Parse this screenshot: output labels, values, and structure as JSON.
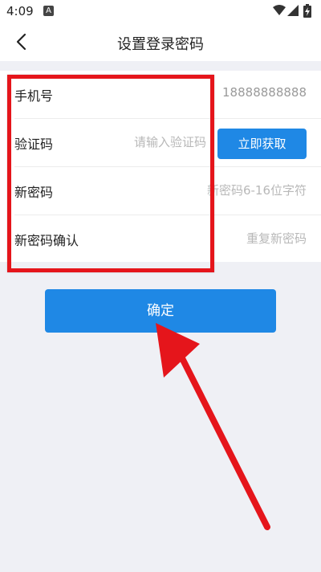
{
  "status_bar": {
    "time": "4:09",
    "a_icon": "A"
  },
  "header": {
    "title": "设置登录密码",
    "back_icon": "chevron-left-icon"
  },
  "form": {
    "phone": {
      "label": "手机号",
      "value": "18888888888"
    },
    "code": {
      "label": "验证码",
      "placeholder": "请输入验证码",
      "button_label": "立即获取"
    },
    "new_password": {
      "label": "新密码",
      "placeholder": "新密码6-16位字符"
    },
    "confirm_password": {
      "label": "新密码确认",
      "placeholder": "重复新密码"
    }
  },
  "confirm_button_label": "确定",
  "colors": {
    "accent": "#1f88e5",
    "annotation": "#e5151b",
    "background": "#eff0f5"
  }
}
